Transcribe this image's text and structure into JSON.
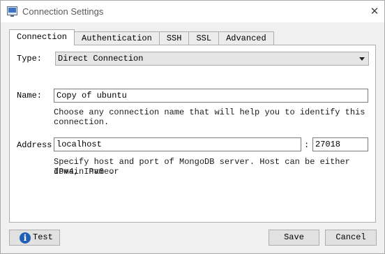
{
  "window": {
    "title": "Connection Settings",
    "icon": "app-window-icon",
    "close_icon": "close-icon"
  },
  "tabs": [
    {
      "label": "Connection",
      "active": true
    },
    {
      "label": "Authentication",
      "active": false
    },
    {
      "label": "SSH",
      "active": false
    },
    {
      "label": "SSL",
      "active": false
    },
    {
      "label": "Advanced",
      "active": false
    }
  ],
  "connection": {
    "type_label": "Type:",
    "type_value": "Direct Connection",
    "name_label": "Name:",
    "name_value": "Copy of ubuntu",
    "name_hint": "Choose any connection name that will help you to identify this connection.",
    "address_label": "Address:",
    "host_value": "localhost",
    "port_separator": ":",
    "port_value": "27018",
    "address_hint_line1": "Specify host and port of MongoDB server. Host can be either IPv4, IPv6 or",
    "address_hint_line2": "domain name."
  },
  "footer": {
    "test_label": "Test",
    "test_icon": "info-icon",
    "save_label": "Save",
    "cancel_label": "Cancel"
  },
  "colors": {
    "window_bg": "#f0f0f0",
    "panel_bg": "#ffffff",
    "info_icon": "#1f5fb6"
  }
}
